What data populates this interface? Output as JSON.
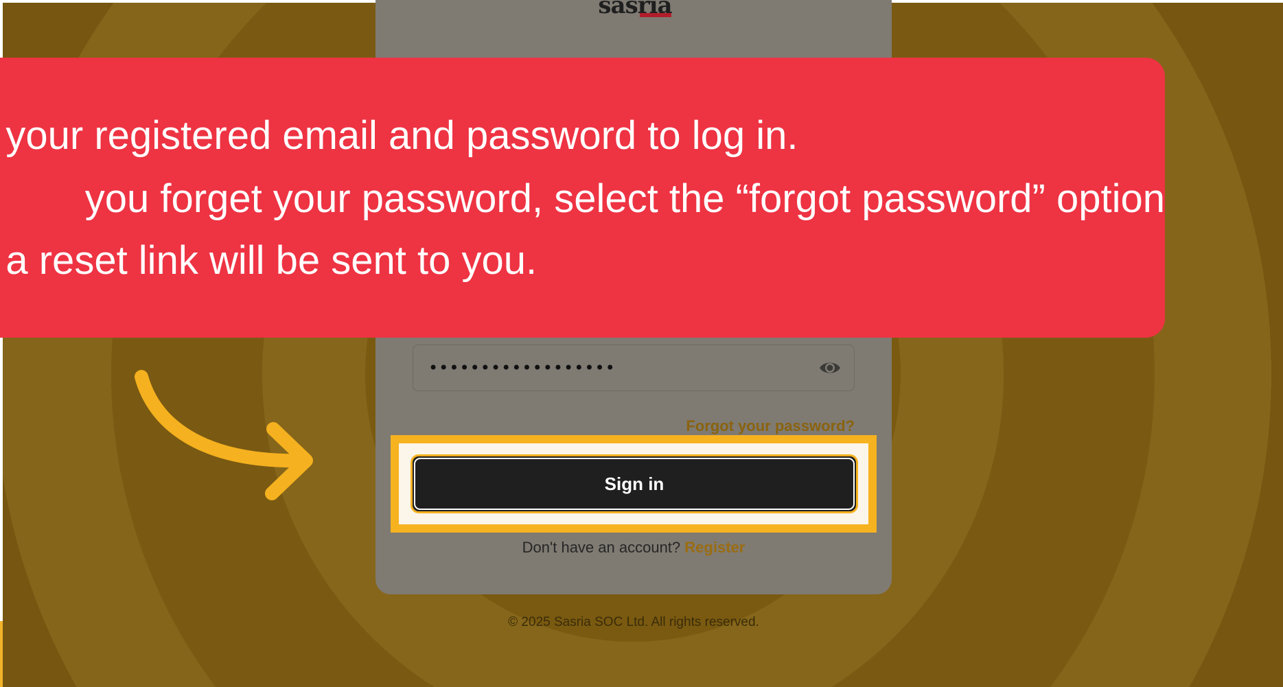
{
  "logo": {
    "text": "sasria"
  },
  "callout": {
    "line1": "e your registered email and password to log in.",
    "line2": "you forget your password, select the “forgot password” option",
    "line3": "d a reset link will be sent to you."
  },
  "login_form": {
    "password_value": "••••••••••••••••••",
    "forgot_password_label": "Forgot your password?",
    "sign_in_label": "Sign in",
    "no_account_text": "Don't have an account?",
    "register_label": "Register"
  },
  "footer": {
    "copyright": "© 2025 Sasria SOC Ltd. All rights reserved."
  },
  "icons": {
    "password_toggle": "eye-icon",
    "pointer": "curved-arrow-icon"
  },
  "colors": {
    "callout": "#ee3343",
    "highlight": "#f6b21f",
    "button": "#1f1f1f",
    "link": "#9a6c12",
    "overlay_background": "#7e5e12"
  }
}
